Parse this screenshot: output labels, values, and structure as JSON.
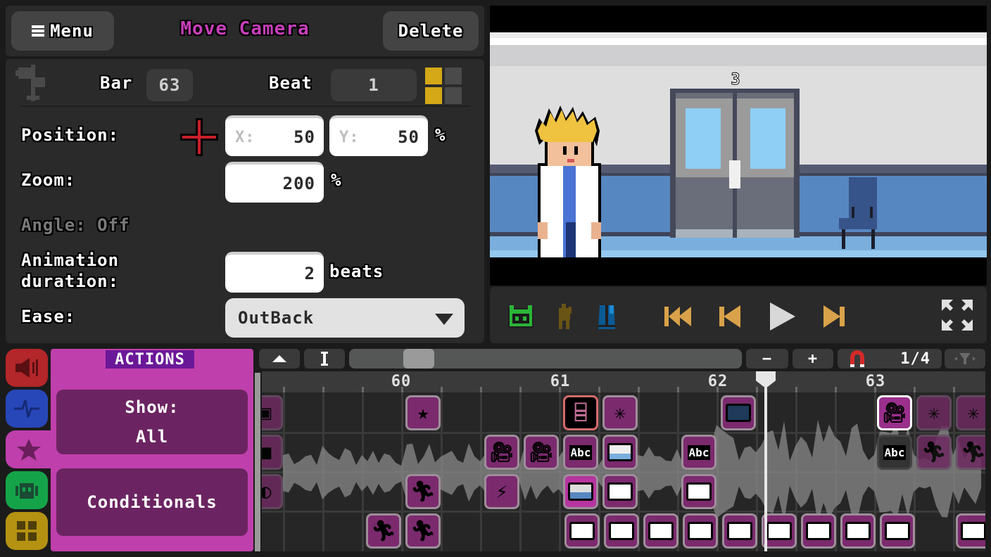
{
  "header": {
    "menu_label": "Menu",
    "title": "Move Camera",
    "delete_label": "Delete"
  },
  "props": {
    "bar_label": "Bar",
    "bar_value": "63",
    "beat_label": "Beat",
    "beat_value": "1",
    "position_label": "Position:",
    "x_placeholder": "X:",
    "x_value": "50",
    "y_placeholder": "Y:",
    "y_value": "50",
    "percent": "%",
    "zoom_label": "Zoom:",
    "zoom_value": "200",
    "angle_label": "Angle: Off",
    "anim_label_1": "Animation",
    "anim_label_2": "duration:",
    "anim_value": "2",
    "anim_unit": "beats",
    "ease_label": "Ease:",
    "ease_value": "OutBack"
  },
  "preview": {
    "room_number": "3"
  },
  "transport": {
    "buttons": [
      "character-icon",
      "metronome-figure-icon",
      "metronome-icon",
      "rewind-to-start",
      "previous-bar",
      "play",
      "next-bar",
      "fullscreen"
    ]
  },
  "categories": [
    {
      "name": "sound",
      "color": "#b3262a"
    },
    {
      "name": "rhythm",
      "color": "#2747b8"
    },
    {
      "name": "actions",
      "color": "#bf3fac"
    },
    {
      "name": "sprites",
      "color": "#15a34a"
    },
    {
      "name": "rooms",
      "color": "#b59212"
    }
  ],
  "actions_panel": {
    "title": "ACTIONS",
    "show_label": "Show:",
    "show_value": "All",
    "conditionals_label": "Conditionals"
  },
  "timeline": {
    "snap_value": "1/4",
    "minus_label": "−",
    "plus_label": "+",
    "bars": [
      "60",
      "61",
      "62",
      "63"
    ],
    "scroll_position": 0.15,
    "playhead_bar": 62.3
  },
  "colors": {
    "accent": "#bf3fac",
    "title_magenta": "#c63fb9",
    "beat_gold": "#d4a817",
    "transport_orange": "#d9a24a",
    "snap_red": "#d42a2a"
  }
}
